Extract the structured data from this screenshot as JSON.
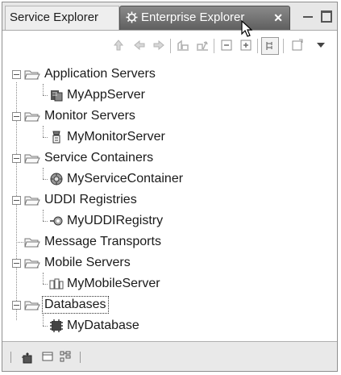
{
  "tabs": [
    {
      "label": "Service Explorer",
      "active": false
    },
    {
      "label": "Enterprise Explorer",
      "active": true,
      "close": "✕"
    }
  ],
  "window_controls": [
    "minimize-icon",
    "maximize-icon"
  ],
  "toolbar": [
    "up-icon",
    "back-icon",
    "forward-icon",
    "deploy-icon",
    "publish-icon",
    "collapse-all-icon",
    "expand-all-icon",
    "link-with-editor-icon",
    "new-icon",
    "view-menu-icon"
  ],
  "tree": {
    "groups": [
      {
        "label": "Application Servers",
        "children": [
          "MyAppServer"
        ],
        "icon": "app-server-icon"
      },
      {
        "label": "Monitor Servers",
        "children": [
          "MyMonitorServer"
        ],
        "icon": "monitor-server-icon"
      },
      {
        "label": "Service Containers",
        "children": [
          "MyServiceContainer"
        ],
        "icon": "service-container-icon"
      },
      {
        "label": "UDDI Registries",
        "children": [
          "MyUDDIRegistry"
        ],
        "icon": "uddi-registry-icon"
      },
      {
        "label": "Message Transports",
        "children": []
      },
      {
        "label": "Mobile Servers",
        "children": [
          "MyMobileServer"
        ],
        "icon": "mobile-server-icon"
      },
      {
        "label": "Databases",
        "children": [
          "MyDatabase"
        ],
        "icon": "database-icon",
        "focused": true
      }
    ]
  },
  "statusbar": [
    "server-status-icon",
    "window-icon",
    "tree-layout-icon"
  ],
  "colors": {
    "active_tab": "#6f6f6f",
    "tab_bar": "#e7e7e7",
    "text": "#1a1a1a"
  }
}
